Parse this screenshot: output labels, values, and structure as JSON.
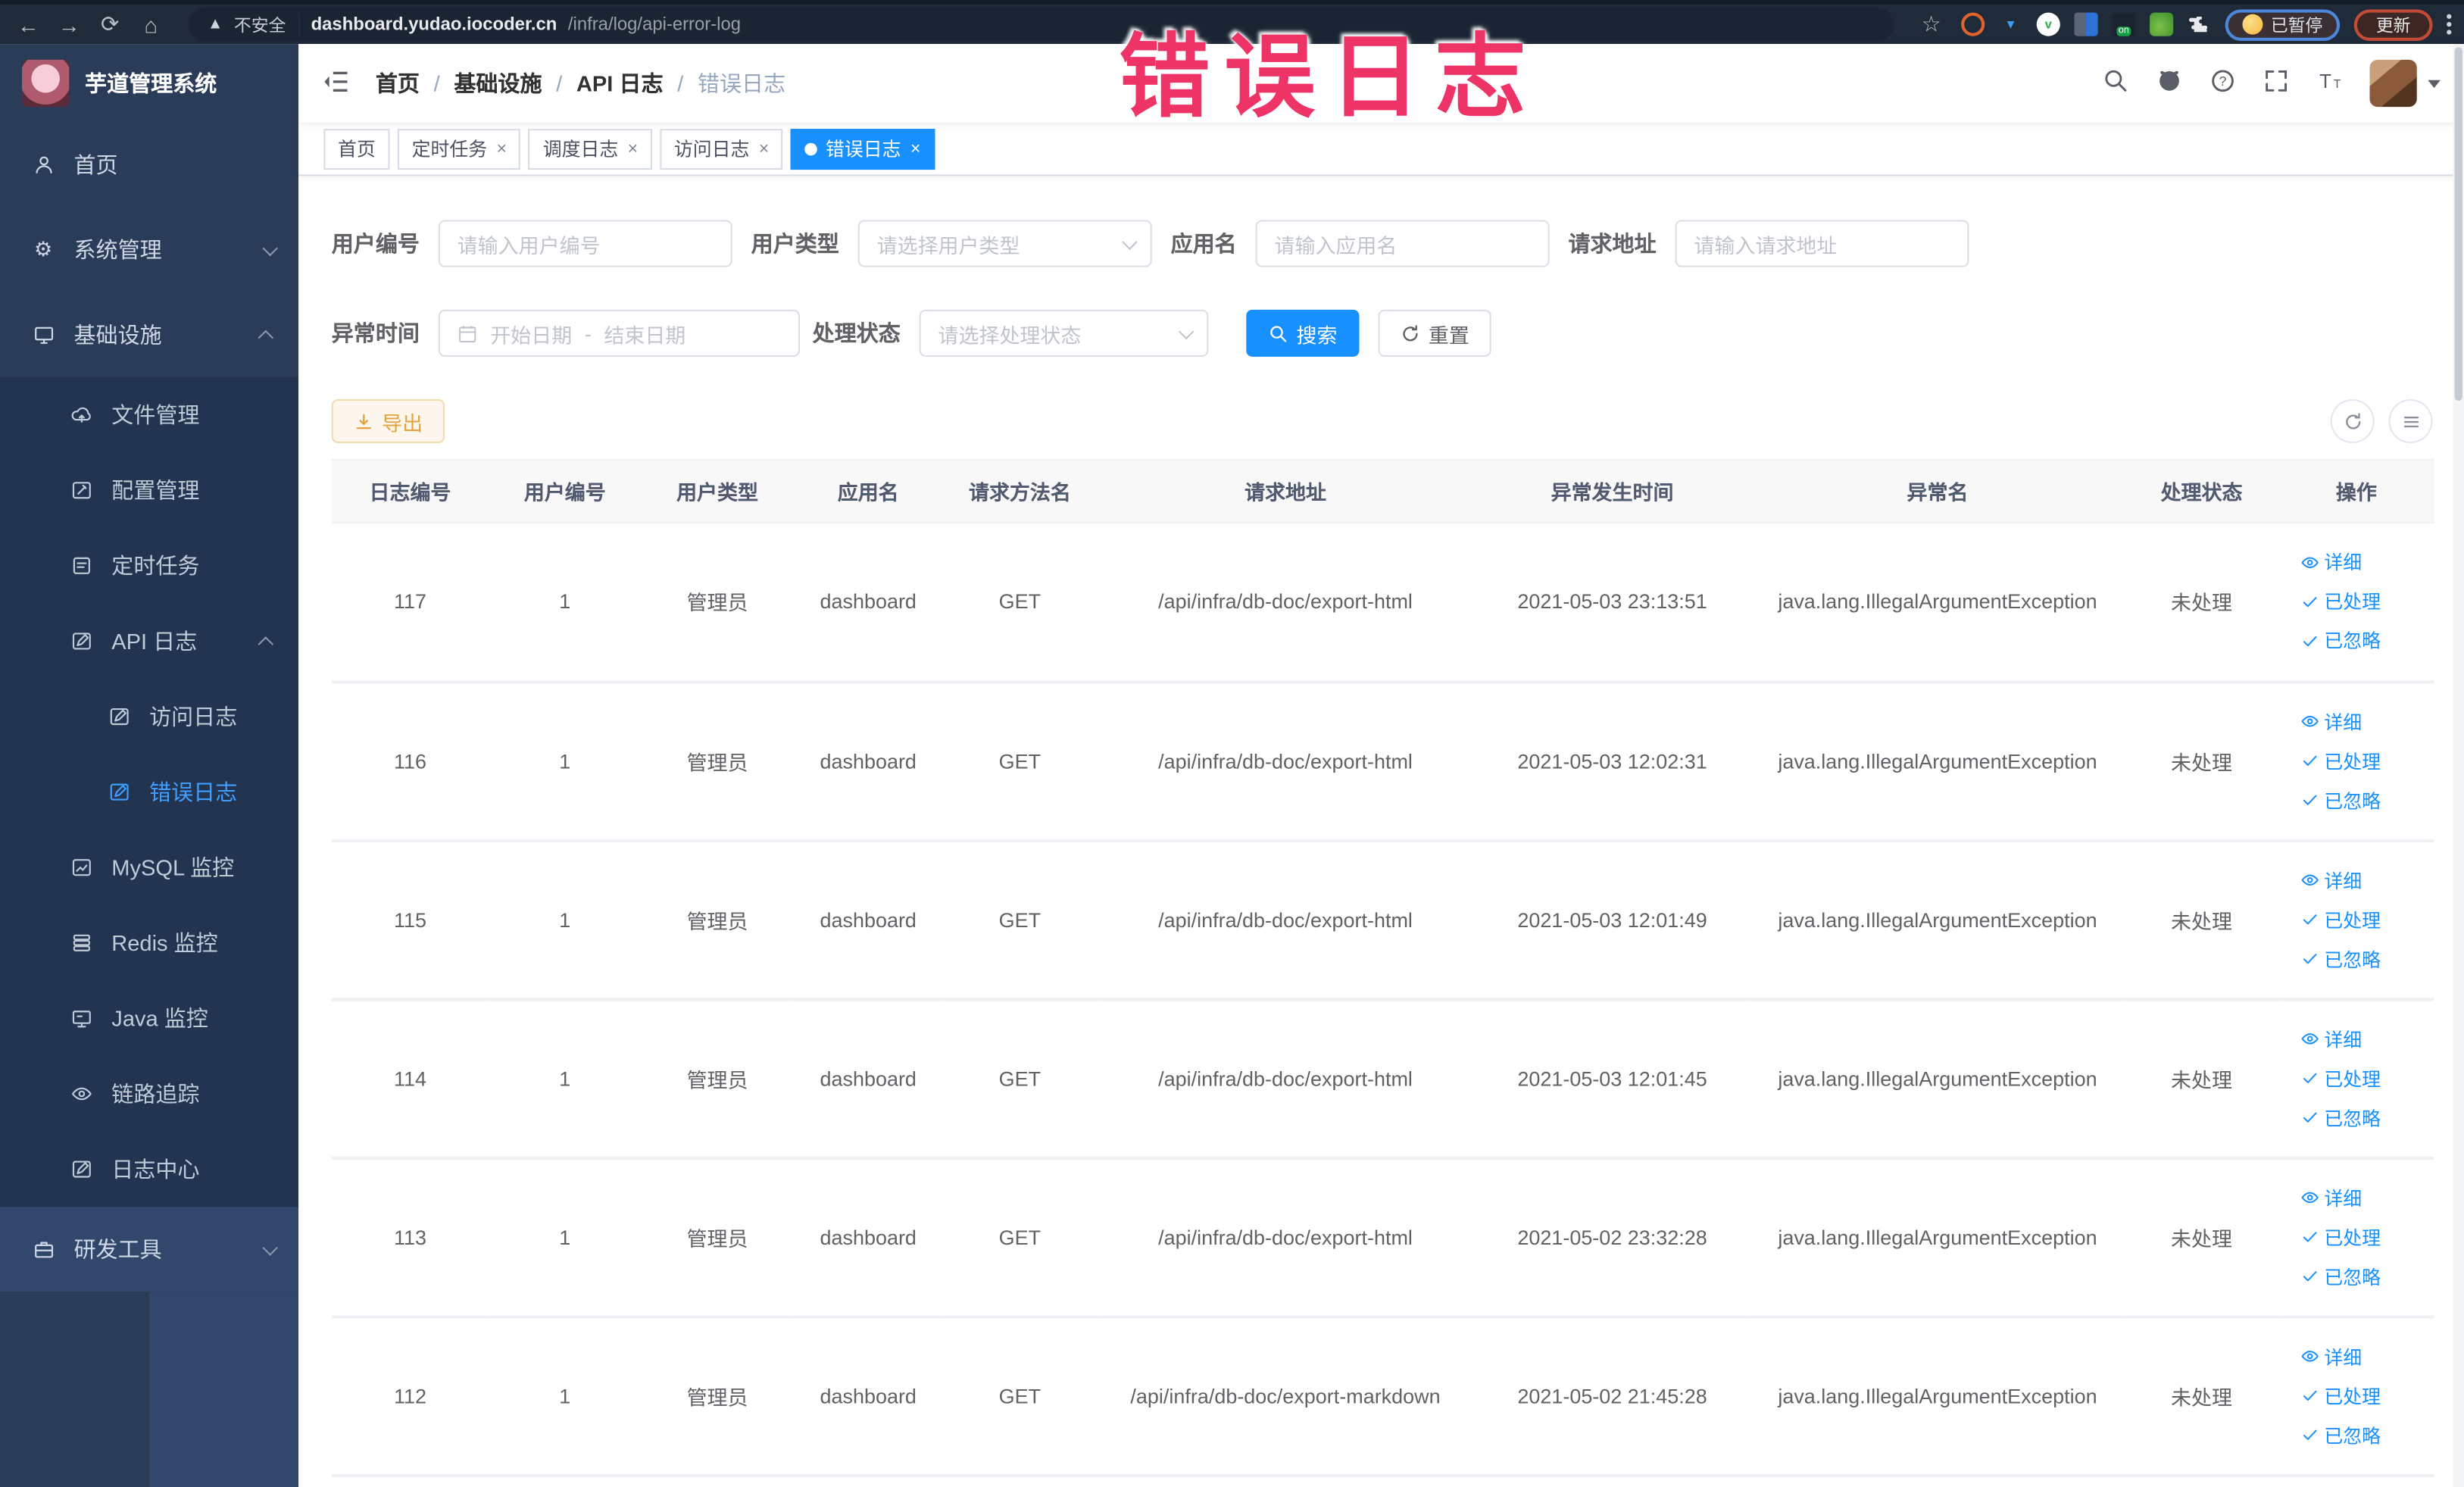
{
  "overlay": {
    "watermark": "错误日志"
  },
  "ui": {
    "close": "×",
    "slash": "/",
    "more_menu": "⋮"
  },
  "browser": {
    "security_label": "不安全",
    "url_host": "dashboard.yudao.iocoder.cn",
    "url_path": "/infra/log/api-error-log",
    "paused_badge": "已暂停",
    "update_button": "更新",
    "on_badge": "on"
  },
  "sidebar": {
    "app_title": "芋道管理系统",
    "home": "首页",
    "system": "系统管理",
    "infra": "基础设施",
    "file": "文件管理",
    "config": "配置管理",
    "job": "定时任务",
    "apilog": "API 日志",
    "accesslog": "访问日志",
    "errorlog": "错误日志",
    "mysql": "MySQL 监控",
    "redis": "Redis 监控",
    "java": "Java 监控",
    "trace": "链路追踪",
    "logcenter": "日志中心",
    "devtool": "研发工具"
  },
  "breadcrumb": {
    "items": [
      "首页",
      "基础设施",
      "API 日志",
      "错误日志"
    ]
  },
  "tabs": [
    {
      "label": "首页"
    },
    {
      "label": "定时任务"
    },
    {
      "label": "调度日志"
    },
    {
      "label": "访问日志"
    },
    {
      "label": "错误日志"
    }
  ],
  "filters": {
    "user_id": {
      "label": "用户编号",
      "placeholder": "请输入用户编号"
    },
    "user_type": {
      "label": "用户类型",
      "placeholder": "请选择用户类型"
    },
    "app_name": {
      "label": "应用名",
      "placeholder": "请输入应用名"
    },
    "request_url": {
      "label": "请求地址",
      "placeholder": "请输入请求地址"
    },
    "exception_time": {
      "label": "异常时间",
      "start_placeholder": "开始日期",
      "separator": "-",
      "end_placeholder": "结束日期"
    },
    "process_status": {
      "label": "处理状态",
      "placeholder": "请选择处理状态"
    },
    "search_button": "搜索",
    "reset_button": "重置"
  },
  "toolbar": {
    "export_button": "导出"
  },
  "table": {
    "columns": [
      "日志编号",
      "用户编号",
      "用户类型",
      "应用名",
      "请求方法名",
      "请求地址",
      "异常发生时间",
      "异常名",
      "处理状态",
      "操作"
    ],
    "action_labels": {
      "detail": "详细",
      "processed": "已处理",
      "ignored": "已忽略"
    },
    "rows": [
      {
        "id": "117",
        "user_id": "1",
        "user_type": "管理员",
        "app": "dashboard",
        "method": "GET",
        "url": "/api/infra/db-doc/export-html",
        "time": "2021-05-03 23:13:51",
        "exception": "java.lang.IllegalArgumentException",
        "status": "未处理"
      },
      {
        "id": "116",
        "user_id": "1",
        "user_type": "管理员",
        "app": "dashboard",
        "method": "GET",
        "url": "/api/infra/db-doc/export-html",
        "time": "2021-05-03 12:02:31",
        "exception": "java.lang.IllegalArgumentException",
        "status": "未处理"
      },
      {
        "id": "115",
        "user_id": "1",
        "user_type": "管理员",
        "app": "dashboard",
        "method": "GET",
        "url": "/api/infra/db-doc/export-html",
        "time": "2021-05-03 12:01:49",
        "exception": "java.lang.IllegalArgumentException",
        "status": "未处理"
      },
      {
        "id": "114",
        "user_id": "1",
        "user_type": "管理员",
        "app": "dashboard",
        "method": "GET",
        "url": "/api/infra/db-doc/export-html",
        "time": "2021-05-03 12:01:45",
        "exception": "java.lang.IllegalArgumentException",
        "status": "未处理"
      },
      {
        "id": "113",
        "user_id": "1",
        "user_type": "管理员",
        "app": "dashboard",
        "method": "GET",
        "url": "/api/infra/db-doc/export-html",
        "time": "2021-05-02 23:32:28",
        "exception": "java.lang.IllegalArgumentException",
        "status": "未处理"
      },
      {
        "id": "112",
        "user_id": "1",
        "user_type": "管理员",
        "app": "dashboard",
        "method": "GET",
        "url": "/api/infra/db-doc/export-markdown",
        "time": "2021-05-02 21:45:28",
        "exception": "java.lang.IllegalArgumentException",
        "status": "未处理"
      }
    ]
  },
  "colors": {
    "accent": "#1890ff",
    "sidebar_bg": "#2b3c59",
    "submenu_bg": "#223450",
    "warning": "#e6a23c",
    "overlay_pink": "#ee3366"
  }
}
